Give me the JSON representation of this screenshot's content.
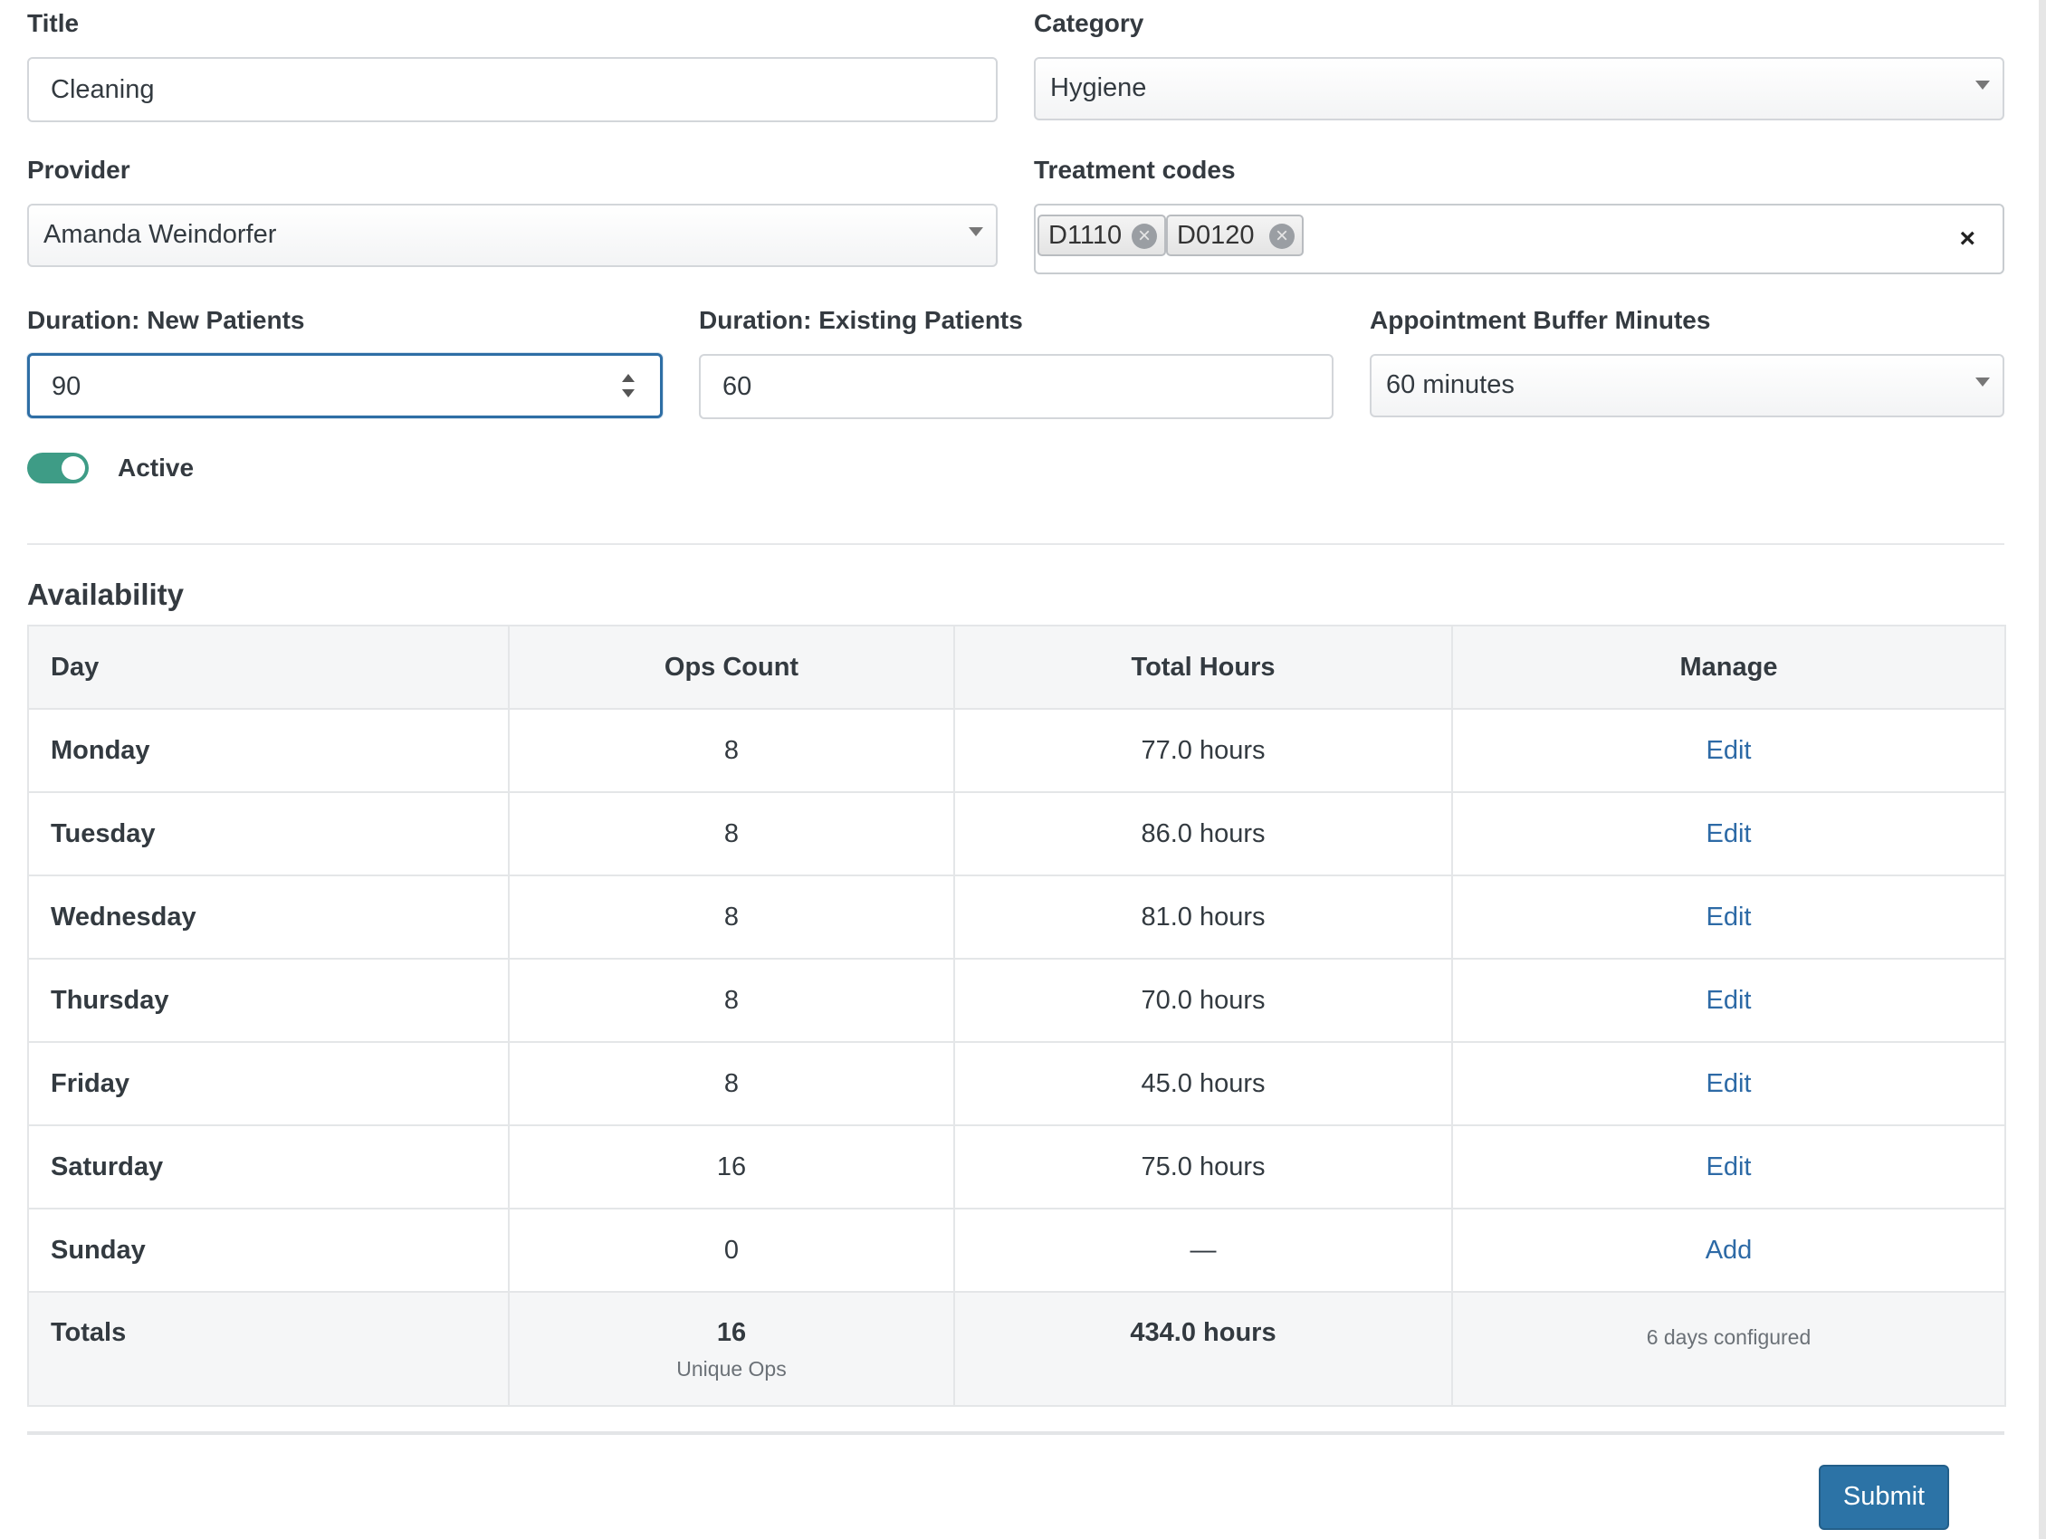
{
  "form": {
    "title": {
      "label": "Title",
      "value": "Cleaning"
    },
    "category": {
      "label": "Category",
      "value": "Hygiene"
    },
    "provider": {
      "label": "Provider",
      "value": "Amanda Weindorfer"
    },
    "treatment_codes": {
      "label": "Treatment codes",
      "tags": [
        "D1110",
        "D0120"
      ],
      "clear_glyph": "×",
      "remove_glyph": "×"
    },
    "duration_new": {
      "label": "Duration: New Patients",
      "value": "90"
    },
    "duration_existing": {
      "label": "Duration: Existing Patients",
      "value": "60"
    },
    "buffer": {
      "label": "Appointment Buffer Minutes",
      "value": "60 minutes"
    },
    "active": {
      "label": "Active",
      "on": true
    }
  },
  "availability": {
    "title": "Availability",
    "headers": [
      "Day",
      "Ops Count",
      "Total Hours",
      "Manage"
    ],
    "rows": [
      {
        "day": "Monday",
        "ops": "8",
        "hours": "77.0 hours",
        "action": "Edit"
      },
      {
        "day": "Tuesday",
        "ops": "8",
        "hours": "86.0 hours",
        "action": "Edit"
      },
      {
        "day": "Wednesday",
        "ops": "8",
        "hours": "81.0 hours",
        "action": "Edit"
      },
      {
        "day": "Thursday",
        "ops": "8",
        "hours": "70.0 hours",
        "action": "Edit"
      },
      {
        "day": "Friday",
        "ops": "8",
        "hours": "45.0 hours",
        "action": "Edit"
      },
      {
        "day": "Saturday",
        "ops": "16",
        "hours": "75.0 hours",
        "action": "Edit"
      },
      {
        "day": "Sunday",
        "ops": "0",
        "hours": "—",
        "action": "Add"
      }
    ],
    "totals": {
      "label": "Totals",
      "ops": "16",
      "ops_sub": "Unique Ops",
      "hours": "434.0 hours",
      "note": "6 days configured"
    }
  },
  "submit_label": "Submit",
  "colors": {
    "accent": "#2c73a6",
    "toggle_on": "#3e9c86",
    "link": "#2d6aa6"
  }
}
